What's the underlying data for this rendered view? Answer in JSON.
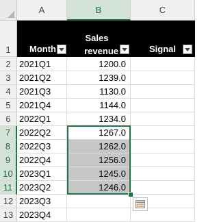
{
  "columns": [
    "A",
    "B",
    "C"
  ],
  "row_numbers": [
    "1",
    "2",
    "3",
    "4",
    "5",
    "6",
    "7",
    "8",
    "9",
    "10",
    "11",
    "12",
    "13"
  ],
  "header": {
    "month": "Month",
    "sales_line1": "Sales",
    "sales_line2": "revenue",
    "signal": "Signal"
  },
  "rows": [
    {
      "month": "2021Q1",
      "sales": "1200.0"
    },
    {
      "month": "2021Q2",
      "sales": "1239.0"
    },
    {
      "month": "2021Q3",
      "sales": "1130.0"
    },
    {
      "month": "2021Q4",
      "sales": "1144.0"
    },
    {
      "month": "2022Q1",
      "sales": "1234.0"
    },
    {
      "month": "2022Q2",
      "sales": "1267.0"
    },
    {
      "month": "2022Q3",
      "sales": "1262.0"
    },
    {
      "month": "2022Q4",
      "sales": "1256.0"
    },
    {
      "month": "2023Q1",
      "sales": "1245.0"
    },
    {
      "month": "2023Q2",
      "sales": "1246.0"
    },
    {
      "month": "2023Q3",
      "sales": ""
    },
    {
      "month": "2023Q4",
      "sales": ""
    }
  ],
  "icons": {
    "filter": "filter-dropdown-icon",
    "quick_analysis": "quick-analysis-icon"
  },
  "colors": {
    "accent": "#217346",
    "selected_header_bg": "#d3e3d7",
    "shaded_cells": "#c6c6c6",
    "header_band": "#000000"
  }
}
